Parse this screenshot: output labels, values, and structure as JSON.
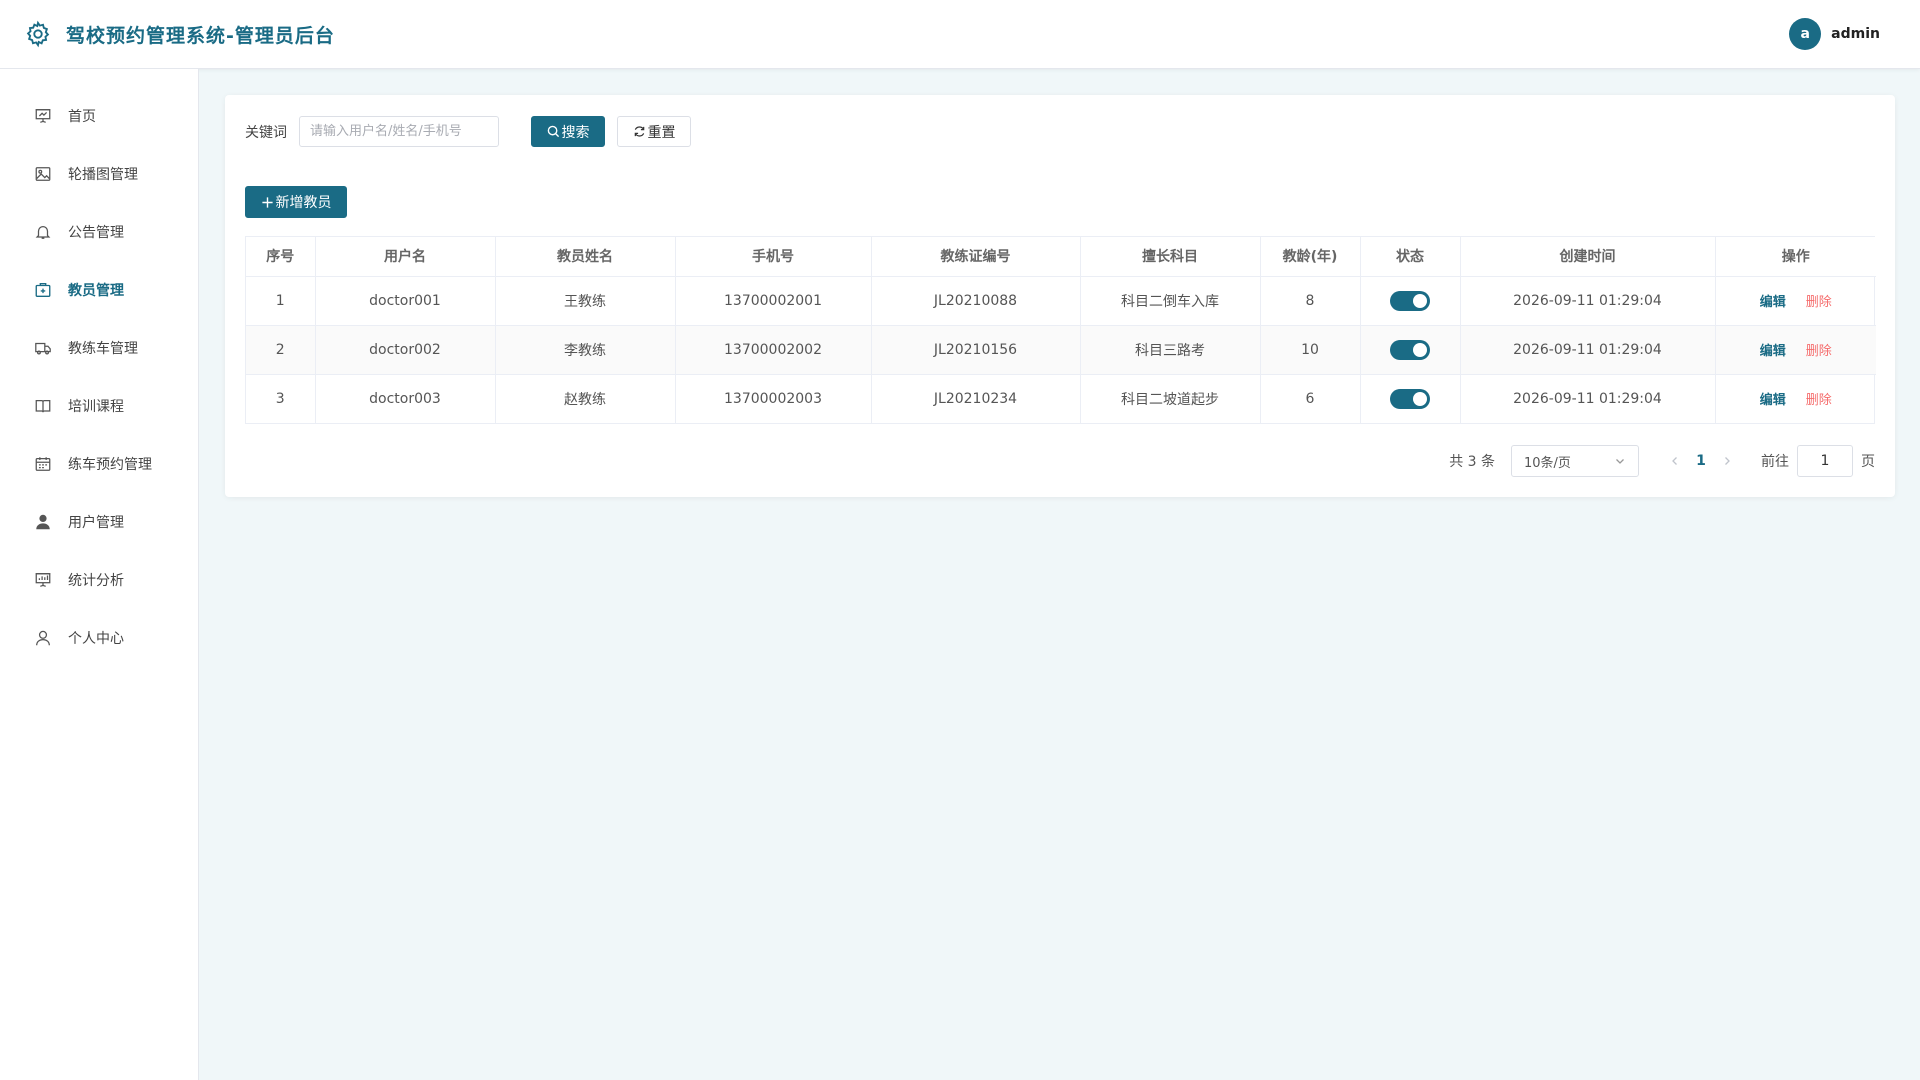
{
  "header": {
    "title": "驾校预约管理系统-管理员后台",
    "logo_icon": "gear-icon",
    "avatar_letter": "a",
    "username": "admin"
  },
  "colors": {
    "primary": "#1a6b85",
    "danger": "#f56c6c",
    "background": "#f0f7f9"
  },
  "sidebar": {
    "items": [
      {
        "label": "首页",
        "icon": "dashboard-icon",
        "active": false
      },
      {
        "label": "轮播图管理",
        "icon": "image-icon",
        "active": false
      },
      {
        "label": "公告管理",
        "icon": "bell-icon",
        "active": false
      },
      {
        "label": "教员管理",
        "icon": "first-aid-kit-icon",
        "active": true
      },
      {
        "label": "教练车管理",
        "icon": "truck-icon",
        "active": false
      },
      {
        "label": "培训课程",
        "icon": "book-icon",
        "active": false
      },
      {
        "label": "练车预约管理",
        "icon": "calendar-icon",
        "active": false
      },
      {
        "label": "用户管理",
        "icon": "user-filled-icon",
        "active": false
      },
      {
        "label": "统计分析",
        "icon": "chart-icon",
        "active": false
      },
      {
        "label": "个人中心",
        "icon": "user-icon",
        "active": false
      }
    ]
  },
  "search": {
    "label": "关键词",
    "placeholder": "请输入用户名/姓名/手机号",
    "value": "",
    "search_button": "搜索",
    "reset_button": "重置"
  },
  "toolbar": {
    "add_button": "新增教员"
  },
  "table": {
    "columns": [
      "序号",
      "用户名",
      "教员姓名",
      "手机号",
      "教练证编号",
      "擅长科目",
      "教龄(年)",
      "状态",
      "创建时间",
      "操作"
    ],
    "rows": [
      {
        "index": "1",
        "username": "doctor001",
        "name": "王教练",
        "phone": "13700002001",
        "cert": "JL20210088",
        "subject": "科目二倒车入库",
        "years": "8",
        "enabled": true,
        "created": "2026-09-11 01:29:04"
      },
      {
        "index": "2",
        "username": "doctor002",
        "name": "李教练",
        "phone": "13700002002",
        "cert": "JL20210156",
        "subject": "科目三路考",
        "years": "10",
        "enabled": true,
        "created": "2026-09-11 01:29:04"
      },
      {
        "index": "3",
        "username": "doctor003",
        "name": "赵教练",
        "phone": "13700002003",
        "cert": "JL20210234",
        "subject": "科目二坡道起步",
        "years": "6",
        "enabled": true,
        "created": "2026-09-11 01:29:04"
      }
    ],
    "actions": {
      "edit": "编辑",
      "delete": "删除"
    }
  },
  "pagination": {
    "total_text": "共 3 条",
    "page_size": "10条/页",
    "current_page": "1",
    "goto_label": "前往",
    "goto_value": "1",
    "goto_unit": "页"
  }
}
